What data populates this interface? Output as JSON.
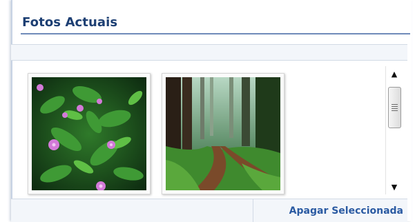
{
  "panel": {
    "title": "Fotos Actuais"
  },
  "photos": [
    {
      "subject": "pink wildflowers among green leaves",
      "selected": false
    },
    {
      "subject": "forest path with tall trees",
      "selected": false
    }
  ],
  "scrollbar": {
    "up_glyph": "▲",
    "down_glyph": "▼",
    "position": 0
  },
  "actions": {
    "delete_selected_label": "Apagar Seleccionada"
  },
  "colors": {
    "title": "#1d3f73",
    "title_rule": "#6f8bb9",
    "link": "#2a5aa2",
    "bar_background": "#f3f6fa"
  }
}
